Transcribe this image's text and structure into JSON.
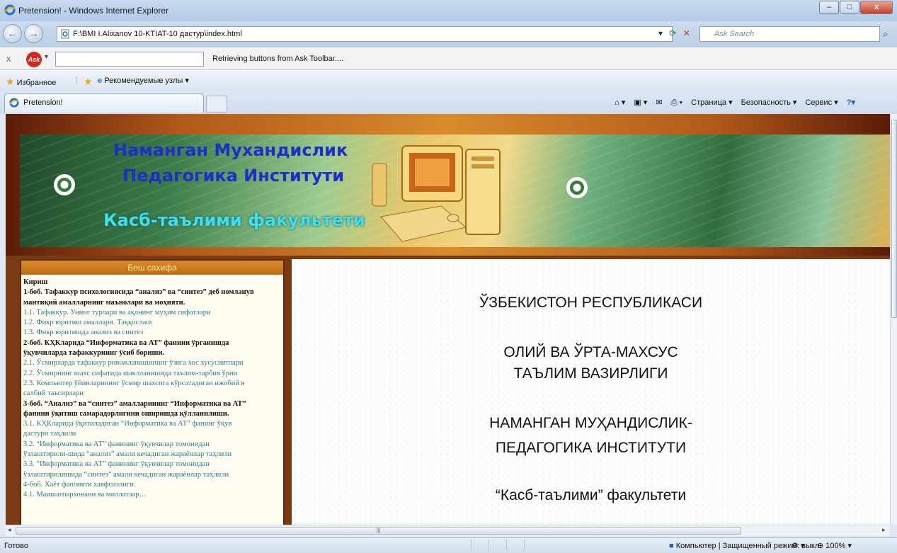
{
  "window": {
    "title": "Pretension! - Windows Internet Explorer",
    "min_label": "–",
    "max_label": "□",
    "close_label": "x"
  },
  "address": {
    "url": "F:\\BMI I.Alixanov 10-KTIAT-10 дастур\\index.html",
    "search_placeholder": "Ask Search",
    "back_icon": "←",
    "forward_icon": "→"
  },
  "ask_toolbar": {
    "close": "x",
    "status": "Retrieving buttons from Ask Toolbar...."
  },
  "favorites": {
    "favorites_label": "Избранное",
    "suggested_label": "Рекомендуемые узлы ▾"
  },
  "tab": {
    "title": "Pretension!"
  },
  "command_bar": {
    "page": "Страница ▾",
    "safety": "Безопасность ▾",
    "tools": "Сервис ▾",
    "help": "?▾"
  },
  "banner": {
    "line1": "Наманган Мухандислик",
    "line2": "Педагогика Институти",
    "line3": "Касб-таълими факультети"
  },
  "sidebar": {
    "header": "Бош сахифа",
    "items": [
      {
        "text": "Кириш",
        "kind": "h"
      },
      {
        "text": "1-боб. Тафаккур психологиясида “анализ” ва “синтез” деб номланув",
        "kind": "h"
      },
      {
        "text": "мантиқий амалларнинг маънолари ва моҳияти.",
        "kind": "h"
      },
      {
        "text": "1.1. Тафаккур. Унинг турлари ва ақлнинг муҳим сифатлари",
        "kind": "l"
      },
      {
        "text": "1.2. Фикр юритиш амаллари. Таққослаш",
        "kind": "l"
      },
      {
        "text": "1.3. Фикр юритишда анализ ва синтез",
        "kind": "l"
      },
      {
        "text": "2-боб. КҲКларида “Информатика ва АТ” фанини ўрганишда",
        "kind": "h"
      },
      {
        "text": "ўқувчиларда тафаккурнинг ўсиб бориши.",
        "kind": "h"
      },
      {
        "text": "2.1. Ўсмирларда тафаккур ривожланишининг ўзига хос хусусиятлари",
        "kind": "l"
      },
      {
        "text": "2.2. Ўсмирнинг шахс сифатида шаклланишида таълим-тарбия ўрни",
        "kind": "l"
      },
      {
        "text": "2.3. Компьютер ўйинларининг ўсмир шахсига кўрсатадиган ижобий в",
        "kind": "l"
      },
      {
        "text": "салбий таъсирлари",
        "kind": "l"
      },
      {
        "text": "3-боб. “Анализ” ва “синтез” амалларининг “Информатика ва АТ”",
        "kind": "h"
      },
      {
        "text": "фанини ўқитиш самарадорлигини оширишда қўлланилиши.",
        "kind": "h"
      },
      {
        "text": "3.1. КҲКларида ўқитиладиган “Информатика ва АТ” фанинг ўқув",
        "kind": "l"
      },
      {
        "text": "дастури таҳлили",
        "kind": "l"
      },
      {
        "text": "3.2. “Информатика ва АТ” фанининг ўқувчилар томонидан",
        "kind": "l"
      },
      {
        "text": "ўзлаштирили-шида “анализ” амали кечадиган жараёнлар таҳлили",
        "kind": "l"
      },
      {
        "text": "3.3. “Информатика ва АТ” фанининг ўқувчилар томонидан",
        "kind": "l"
      },
      {
        "text": "ўзлаштирилишида “синтез” амали кечадиган жараёнлар таҳлили",
        "kind": "l"
      },
      {
        "text": "4-боб. Хаёт фаолияти хавфсизлиги.",
        "kind": "l"
      },
      {
        "text": "4.1. Маишатпархонани ва миллатлар…",
        "kind": "l"
      }
    ]
  },
  "main": {
    "line1": "ЎЗБЕКИСТОН РЕСПУБЛИКАСИ",
    "line2": "ОЛИЙ ВА ЎРТА-МАХСУС",
    "line3": "ТАЪЛИМ ВАЗИРЛИГИ",
    "line4": "НАМАНГАН МУҲАНДИСЛИК-",
    "line5": "ПЕДАГОГИКА ИНСТИТУТИ",
    "line6": "“Касб-таълими” факультети"
  },
  "scrollbar": {
    "grip": "|||"
  },
  "status": {
    "ready": "Готово",
    "zone": "Компьютер | Защищенный режим: выкл.",
    "zoom": "100% ▾"
  },
  "colors": {
    "banner_title": "#1d2fc7",
    "banner_faculty": "#3fe0e8",
    "toc_heading": "#111111",
    "toc_link": "#2e7c8f",
    "frame_brown": "#7a3a12"
  }
}
